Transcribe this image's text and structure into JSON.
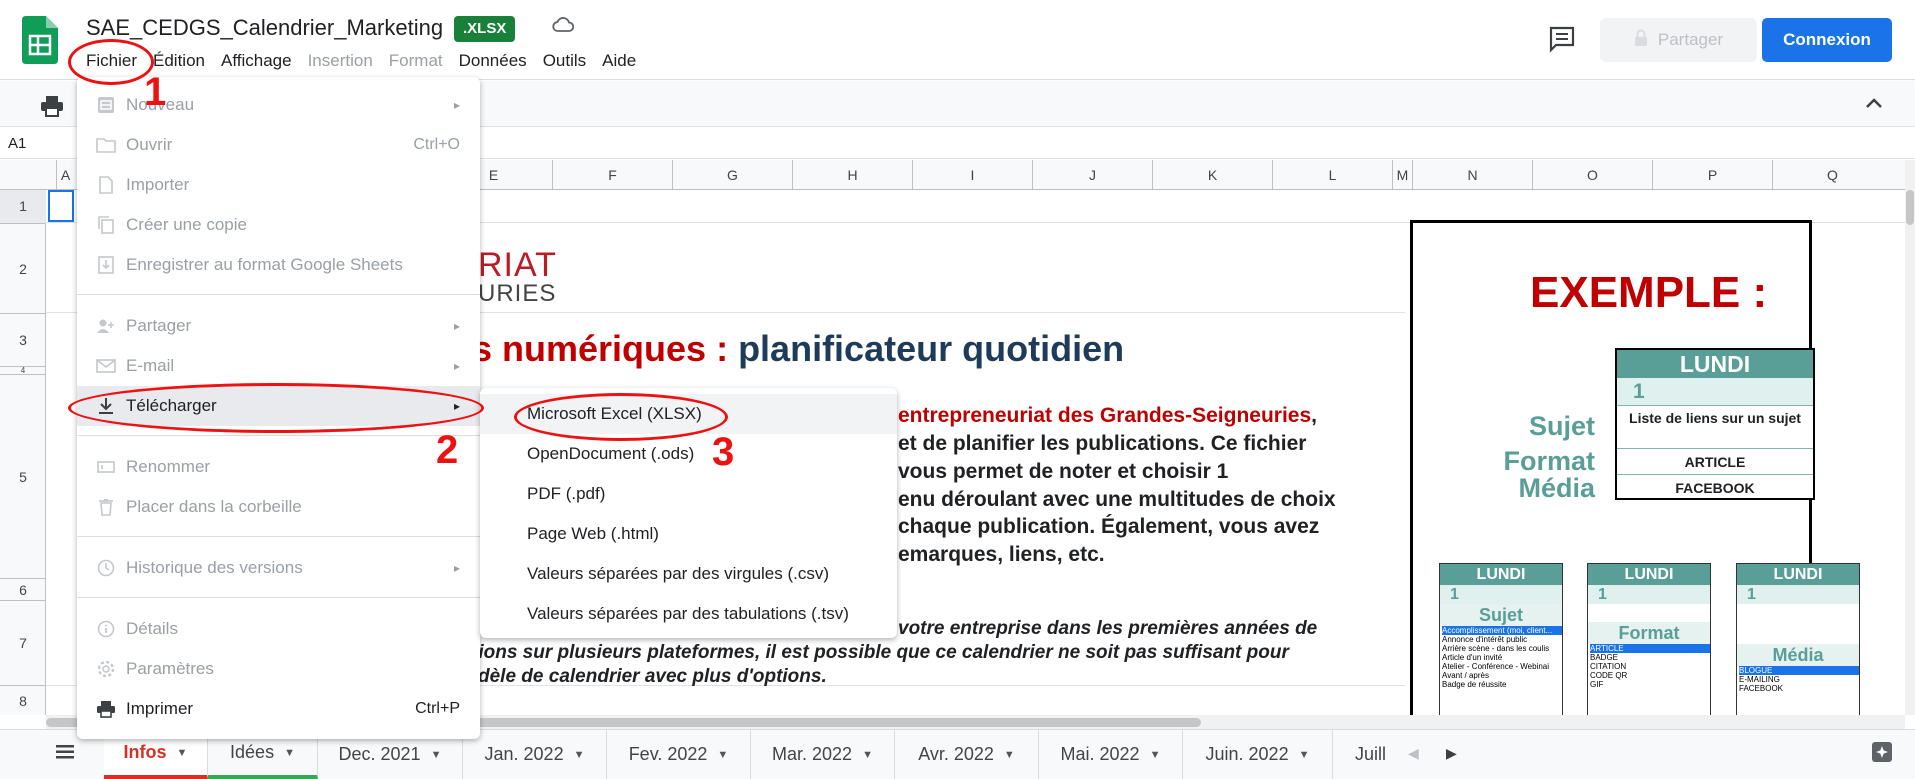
{
  "header": {
    "doc_title": "SAE_CEDGS_Calendrier_Marketing",
    "badge": ".XLSX",
    "share_label": "Partager",
    "login_label": "Connexion",
    "menus": [
      {
        "label": "Fichier",
        "enabled": true
      },
      {
        "label": "Édition",
        "enabled": true
      },
      {
        "label": "Affichage",
        "enabled": true
      },
      {
        "label": "Insertion",
        "enabled": false
      },
      {
        "label": "Format",
        "enabled": false
      },
      {
        "label": "Données",
        "enabled": true
      },
      {
        "label": "Outils",
        "enabled": true
      },
      {
        "label": "Aide",
        "enabled": true
      }
    ]
  },
  "namebox": {
    "cell": "A1"
  },
  "grid": {
    "columns": [
      "A",
      "E",
      "F",
      "G",
      "H",
      "I",
      "J",
      "K",
      "L",
      "M",
      "N",
      "O",
      "P",
      "Q"
    ],
    "rows": [
      "1",
      "2",
      "3",
      "4",
      "5",
      "6",
      "7",
      "8"
    ]
  },
  "file_menu": {
    "items": [
      {
        "label": "Nouveau",
        "icon": "new-sheet-icon",
        "arrow": "▸"
      },
      {
        "label": "Ouvrir",
        "icon": "folder-icon",
        "shortcut": "Ctrl+O"
      },
      {
        "label": "Importer",
        "icon": "file-icon"
      },
      {
        "label": "Créer une copie",
        "icon": "copy-icon"
      },
      {
        "label": "Enregistrer au format Google Sheets",
        "icon": "save-icon"
      },
      {
        "label": "Partager",
        "icon": "share-person-icon",
        "arrow": "▸"
      },
      {
        "label": "E-mail",
        "icon": "mail-icon",
        "arrow": "▸"
      },
      {
        "label": "Télécharger",
        "icon": "download-icon",
        "arrow": "▸"
      },
      {
        "label": "Renommer",
        "icon": "rename-icon"
      },
      {
        "label": "Placer dans la corbeille",
        "icon": "trash-icon"
      },
      {
        "label": "Historique des versions",
        "icon": "history-icon",
        "arrow": "▸"
      },
      {
        "label": "Détails",
        "icon": "info-icon"
      },
      {
        "label": "Paramètres",
        "icon": "gear-icon"
      },
      {
        "label": "Imprimer",
        "icon": "print-icon",
        "shortcut": "Ctrl+P"
      }
    ]
  },
  "download_menu": {
    "items": [
      "Microsoft Excel (XLSX)",
      "OpenDocument (.ods)",
      "PDF (.pdf)",
      "Page Web (.html)",
      "Valeurs séparées par des virgules (.csv)",
      "Valeurs séparées par des tabulations (.tsv)"
    ]
  },
  "sheet": {
    "brand_line1": "RIAT",
    "brand_line2": "URIES",
    "heading_red": "s numériques : ",
    "heading_blue": "planificateur quotidien",
    "para_line1_red": "entrepreneuriat des Grandes-Seigneuries",
    "para_line1_end": ",",
    "para_line2": "et de planifier les publications. Ce fichier",
    "para_line3": "vous permet de noter et choisir 1",
    "para_line4": "enu déroulant avec une multitudes de choix",
    "para_line5": "chaque publication. Également, vous avez",
    "para_line6": "emarques, liens, etc.",
    "italic_line1": "votre entreprise dans les premières années de",
    "italic_line2": "tions sur plusieurs plateformes, il est possible que ce calendrier ne soit pas suffisant pour",
    "italic_line3": "dèle de calendrier avec plus d'options."
  },
  "example": {
    "title": "EXEMPLE :",
    "side_labels": [
      "Sujet",
      "Format",
      "Média"
    ],
    "card": {
      "day": "LUNDI",
      "num": "1",
      "sujet": "Liste de liens sur un sujet",
      "format": "ARTICLE",
      "media": "FACEBOOK"
    },
    "mini_cards": [
      {
        "day": "LUNDI",
        "num": "1",
        "label": "Sujet",
        "list": [
          "Accomplissement (moi, client...",
          "Annonce d'intérêt public",
          "Arrière scène - dans les coulis",
          "Article d'un invité",
          "Atelier - Conférence - Webinai",
          "Avant / après",
          "Badge de réussite"
        ]
      },
      {
        "day": "LUNDI",
        "num": "1",
        "label": "Format",
        "list": [
          "ARTICLE",
          "BADGE",
          "CITATION",
          "CODE QR",
          "GIF"
        ]
      },
      {
        "day": "LUNDI",
        "num": "1",
        "label": "Média",
        "list": [
          "BLOGUE",
          "E-MAILING",
          "FACEBOOK"
        ]
      }
    ]
  },
  "tabs": [
    "Infos",
    "Idées",
    "Dec. 2021",
    "Jan. 2022",
    "Fev. 2022",
    "Mar. 2022",
    "Avr. 2022",
    "Mai. 2022",
    "Juin. 2022",
    "Juill"
  ],
  "annotations": [
    "1",
    "2",
    "3"
  ],
  "colors": {
    "accent": "#1a73e8",
    "sheets_green": "#188038",
    "annotation_red": "#e11",
    "teal": "#5a9e98"
  }
}
